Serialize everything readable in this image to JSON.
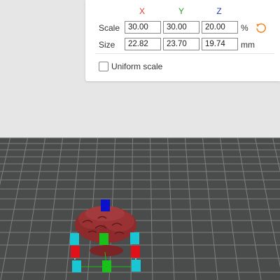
{
  "scale_panel": {
    "axes": {
      "x": "X",
      "y": "Y",
      "z": "Z"
    },
    "scale": {
      "label": "Scale",
      "x": "30.00",
      "y": "30.00",
      "z": "20.00",
      "unit": "%"
    },
    "size": {
      "label": "Size",
      "x": "22.82",
      "y": "23.70",
      "z": "19.74",
      "unit": "mm"
    },
    "uniform_scale": {
      "label": "Uniform scale",
      "checked": false
    },
    "reset_icon": "undo-arrow-icon",
    "colors": {
      "x": "#e03a30",
      "y": "#2a9a2a",
      "z": "#2a3aa8",
      "reset": "#f08a24"
    }
  },
  "viewport": {
    "background_color": "#e6e6e6",
    "build_plate_color": "#4a4b4b",
    "grid_line_color": "#7e8080",
    "model_color": "#8c2a2c",
    "handle_colors": {
      "x": "#e0111b",
      "y": "#18c21a",
      "z": "#0a11cc",
      "corner": "#18c7d3"
    }
  }
}
